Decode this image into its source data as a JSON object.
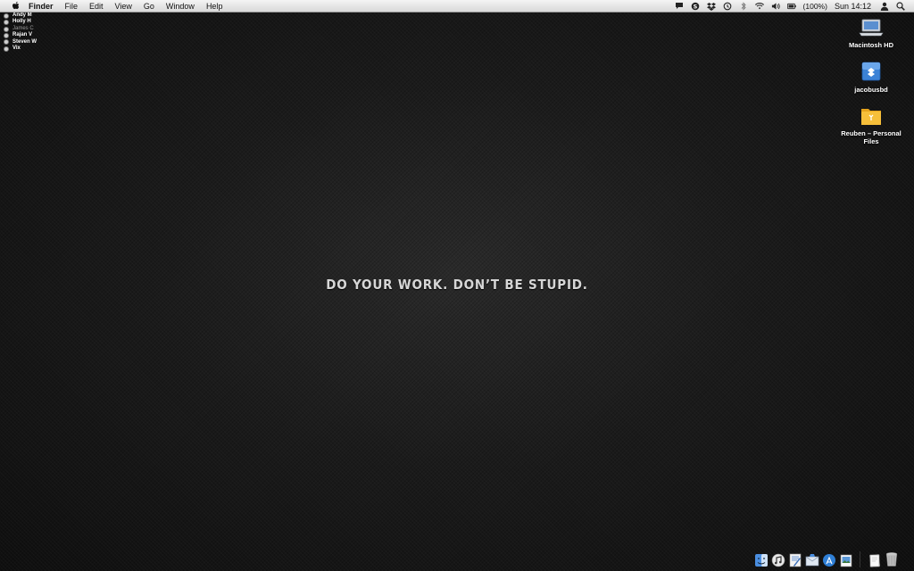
{
  "menubar": {
    "app_name": "Finder",
    "items": [
      "File",
      "Edit",
      "View",
      "Go",
      "Window",
      "Help"
    ],
    "battery": "(100%)",
    "clock": "Sun 14:12"
  },
  "buddies": [
    {
      "name": "Andy M",
      "status": "available"
    },
    {
      "name": "Holly H",
      "status": "available"
    },
    {
      "name": "James C",
      "status": "away"
    },
    {
      "name": "Rajan V",
      "status": "available"
    },
    {
      "name": "Steven W",
      "status": "available"
    },
    {
      "name": "Vix",
      "status": "available"
    }
  ],
  "desktop_icons": [
    {
      "label": "Macintosh HD",
      "icon": "hard-drive-icon"
    },
    {
      "label": "jacobusbd",
      "icon": "network-volume-icon"
    },
    {
      "label": "Reuben – Personal Files",
      "icon": "shared-folder-icon"
    }
  ],
  "wallpaper_text": "DO YOUR WORK. DON’T BE STUPID.",
  "dock_items": [
    {
      "icon": "finder-icon"
    },
    {
      "icon": "itunes-icon"
    },
    {
      "icon": "textedit-icon"
    },
    {
      "icon": "mail-icon"
    },
    {
      "icon": "app-store-icon"
    },
    {
      "icon": "preview-icon"
    },
    {
      "icon": "documents-stack-icon"
    },
    {
      "icon": "trash-icon"
    }
  ],
  "colors": {
    "menubar": "#e6e6e6",
    "desktop": "#1b1b1b",
    "motto": "#d6d6d6",
    "folder": "#f0b429",
    "blue_icon": "#3b82d6"
  }
}
